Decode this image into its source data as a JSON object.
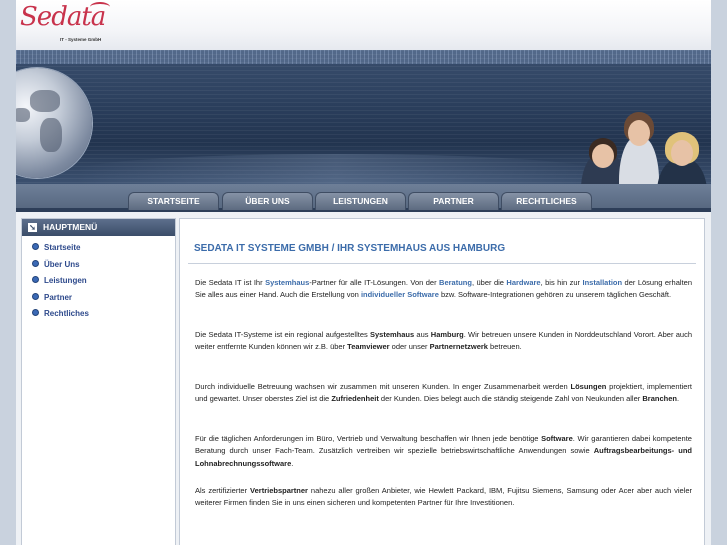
{
  "logo": {
    "word": "Sedata",
    "sub": "IT - Systeme GmbH"
  },
  "nav": [
    "STARTSEITE",
    "ÜBER UNS",
    "LEISTUNGEN",
    "PARTNER",
    "RECHTLICHES"
  ],
  "menu": {
    "title": "HAUPTMENÜ",
    "items": [
      "Startseite",
      "Über Uns",
      "Leistungen",
      "Partner",
      "Rechtliches"
    ]
  },
  "content": {
    "title": "SEDATA IT SYSTEME GMBH / IHR SYSTEMHAUS AUS HAMBURG",
    "p1": {
      "a": "Die Sedata IT ist Ihr ",
      "b": "Systemhaus",
      "c": "-Partner für alle IT-Lösungen. Von der ",
      "d": "Beratung",
      "e": ", über die ",
      "f": "Hardware",
      "g": ", bis hin zur ",
      "h": "Installation",
      "i": " der Lösung erhalten Sie alles aus einer Hand. Auch die Erstellung von ",
      "j": "individueller Software",
      "k": " bzw. Software-Integrationen gehören zu unserem täglichen Geschäft."
    },
    "p2": {
      "a": "Die Sedata IT-Systeme ist ein regional aufgestelltes ",
      "b": "Systemhaus",
      "c": " aus ",
      "d": "Hamburg",
      "e": ". Wir betreuen unsere Kunden in Norddeutschland Vorort. Aber auch weiter entfernte Kunden können wir z.B. über ",
      "f": "Teamviewer",
      "g": " oder unser ",
      "h": "Partnernetzwerk",
      "i": " betreuen."
    },
    "p3": {
      "a": "Durch individuelle Betreuung wachsen wir zusammen mit unseren Kunden. In enger Zusammenarbeit werden ",
      "b": "Lösungen",
      "c": " projektiert, implementiert und gewartet. Unser oberstes Ziel ist die ",
      "d": "Zufriedenheit",
      "e": " der Kunden. Dies belegt auch die ständig steigende Zahl von Neukunden aller ",
      "f": "Branchen",
      "g": "."
    },
    "p4": {
      "a": "Für die täglichen Anforderungen im Büro, Vertrieb und Verwaltung beschaffen wir Ihnen jede benötige ",
      "b": "Software",
      "c": ". Wir garantieren dabei kompetente Beratung durch unser Fach-Team. Zusätzlich vertreiben wir spezielle betriebswirtschaftliche Anwendungen sowie ",
      "d": "Auftragsbearbeitungs- und Lohnabrechnungssoftware",
      "e": "."
    },
    "p5": {
      "a": "Als zertifizierter ",
      "b": "Vertriebspartner",
      "c": " nahezu aller großen Anbieter, wie Hewlett Packard, IBM, Fujitsu Siemens, Samsung oder Acer aber auch vieler weiterer Firmen finden Sie in uns einen sicheren und kompetenten Partner für Ihre Investitionen."
    }
  }
}
